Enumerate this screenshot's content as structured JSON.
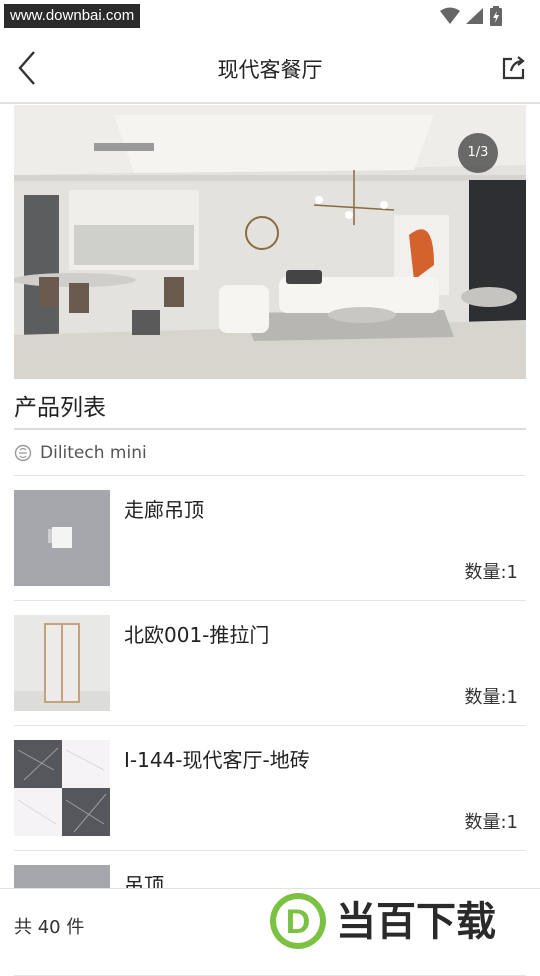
{
  "status_bar": {
    "watermark_url": "www.downbai.com"
  },
  "app_bar": {
    "title": "现代客餐厅"
  },
  "hero": {
    "pager": "1/3"
  },
  "products": {
    "section_title": "产品列表",
    "brand": "Dilitech mini",
    "items": [
      {
        "name": "走廊吊顶",
        "quantity": "数量:1"
      },
      {
        "name": "北欧001-推拉门",
        "quantity": "数量:1"
      },
      {
        "name": "I-144-现代客厅-地砖",
        "quantity": "数量:1"
      },
      {
        "name": "吊顶",
        "quantity": ""
      }
    ]
  },
  "footer": {
    "total": "共 40 件",
    "logo_text": "当百下载",
    "logo_letter": "D"
  },
  "colors": {
    "accent_green": "#7cc242",
    "text": "#222222"
  }
}
